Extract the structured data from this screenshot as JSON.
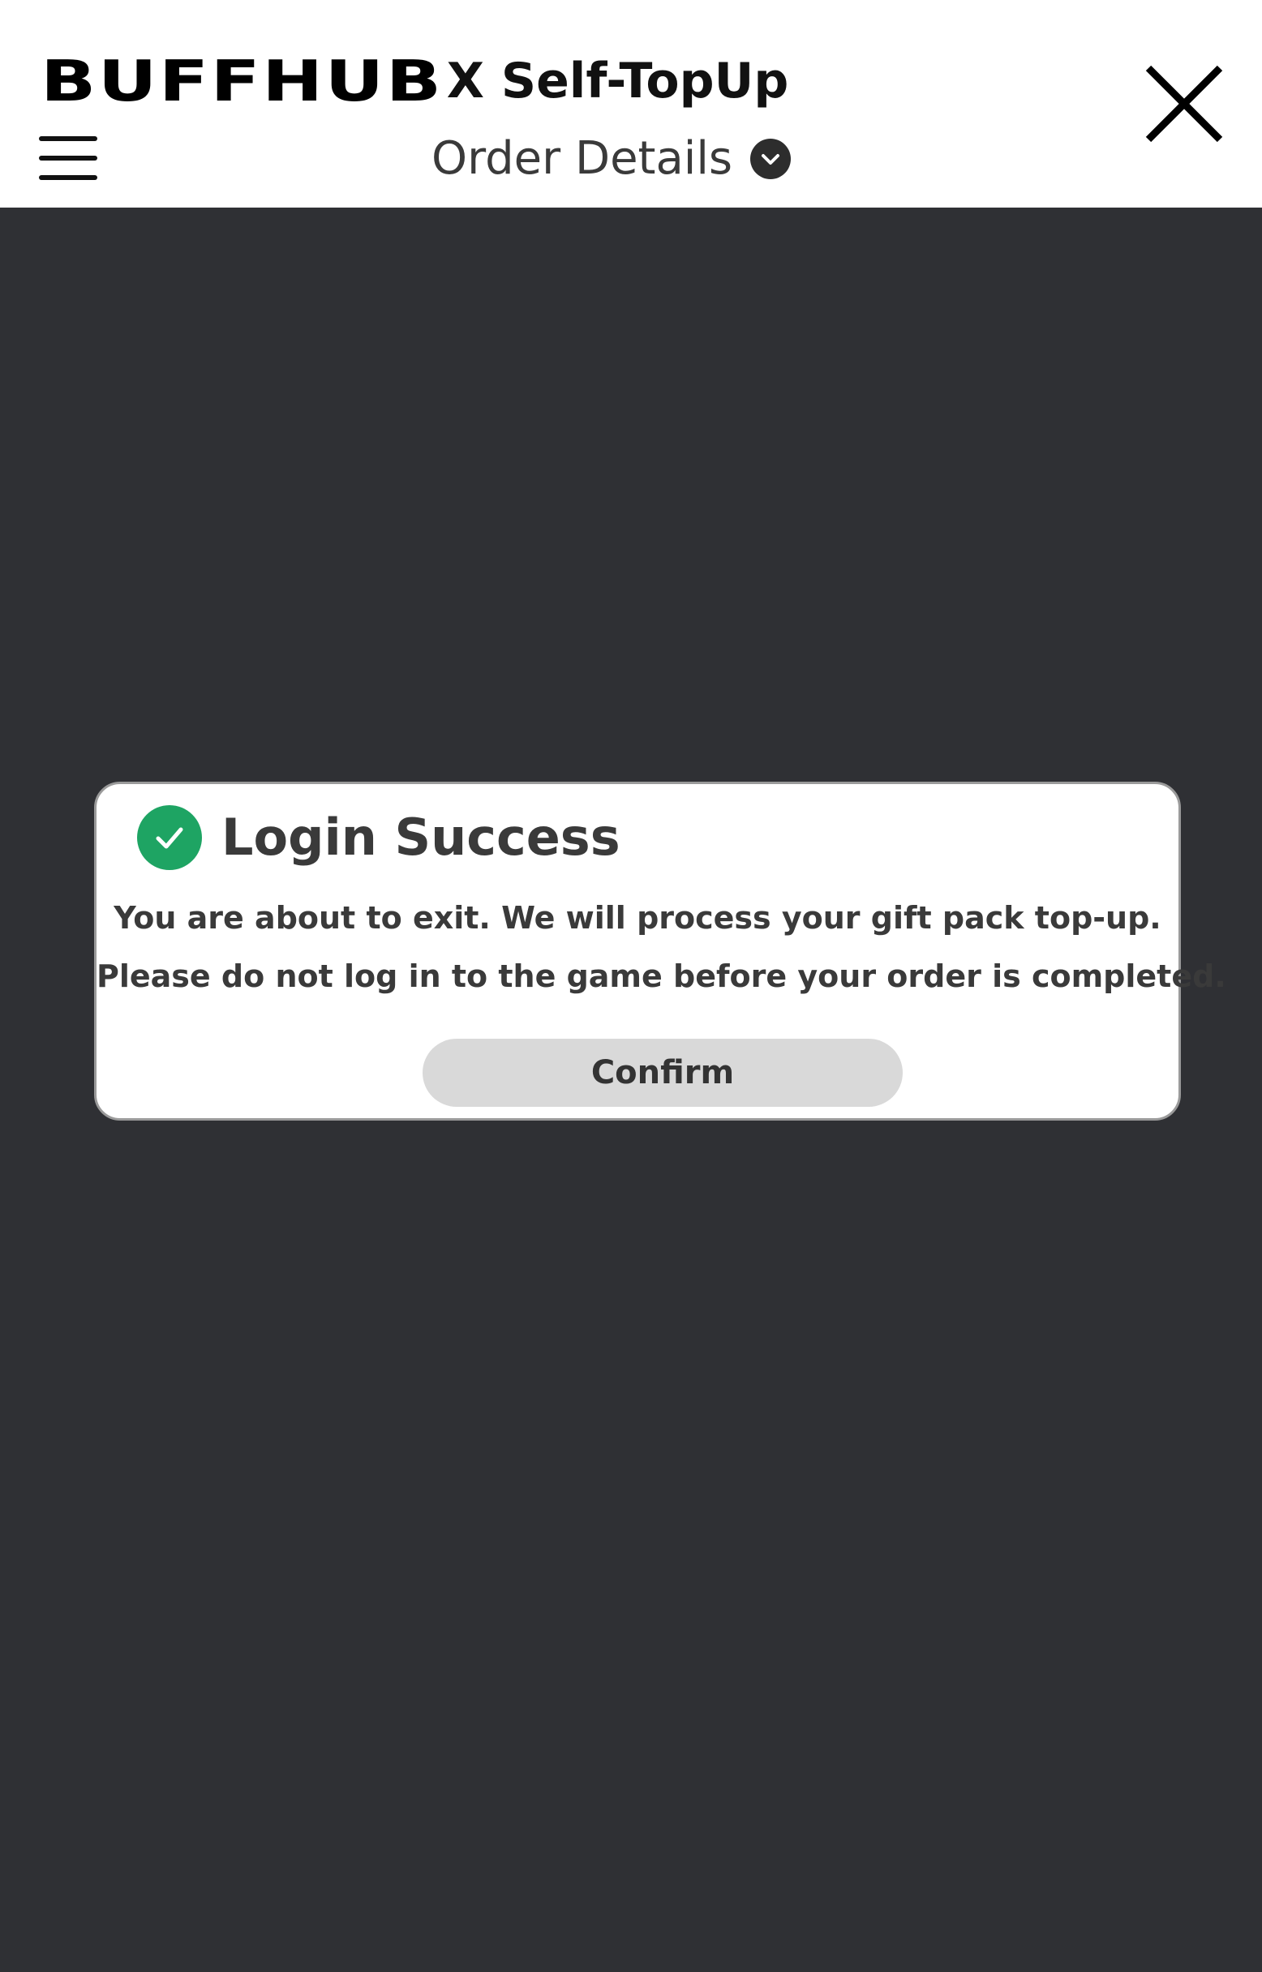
{
  "header": {
    "brand_logo": "BUFFHUB",
    "brand_subtitle": "X Self-TopUp",
    "page_title": "Order Details",
    "menu_icon": "hamburger-menu-icon",
    "close_icon": "close-icon",
    "dropdown_icon": "chevron-down-circle-icon"
  },
  "modal": {
    "icon": "check-circle-icon",
    "title": "Login Success",
    "message_line_1": "You are about to exit. We will process your gift pack top-up.",
    "message_line_2": "Please do not log in to the game before your order is completed.",
    "confirm_label": "Confirm"
  },
  "colors": {
    "header_bg": "#ffffff",
    "backdrop": "#2f3034",
    "success_green": "#1ea463",
    "button_bg": "#d9d9d9",
    "text_dark": "#3a3a3a"
  }
}
